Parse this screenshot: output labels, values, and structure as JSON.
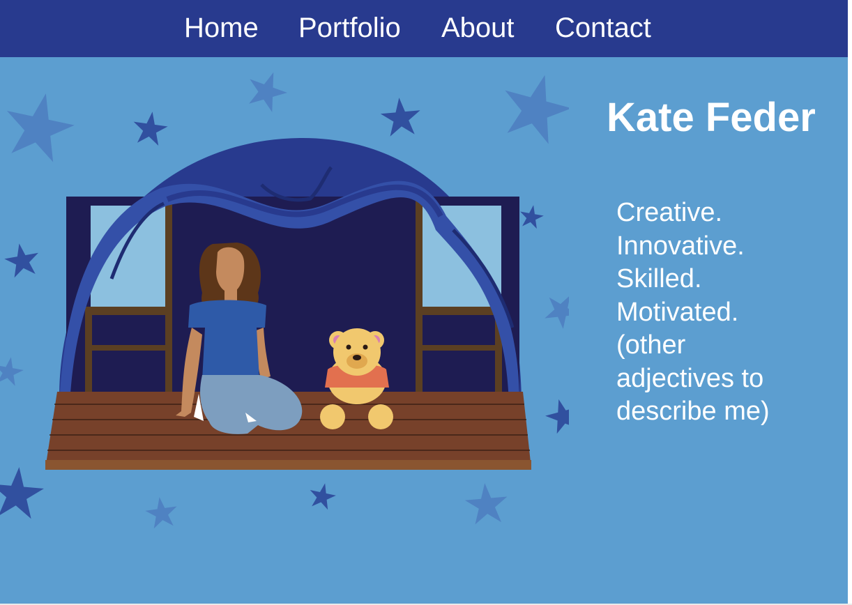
{
  "nav": {
    "items": [
      {
        "label": "Home"
      },
      {
        "label": "Portfolio"
      },
      {
        "label": "About"
      },
      {
        "label": "Contact"
      }
    ]
  },
  "hero": {
    "name": "Kate Feder",
    "tagline": [
      "Creative.",
      "Innovative.",
      "Skilled.",
      "Motivated.",
      "(other",
      "adjectives to",
      "describe me)"
    ]
  },
  "colors": {
    "nav_background": "#283a8e",
    "page_background": "#5c9ed0",
    "text": "#ffffff"
  }
}
